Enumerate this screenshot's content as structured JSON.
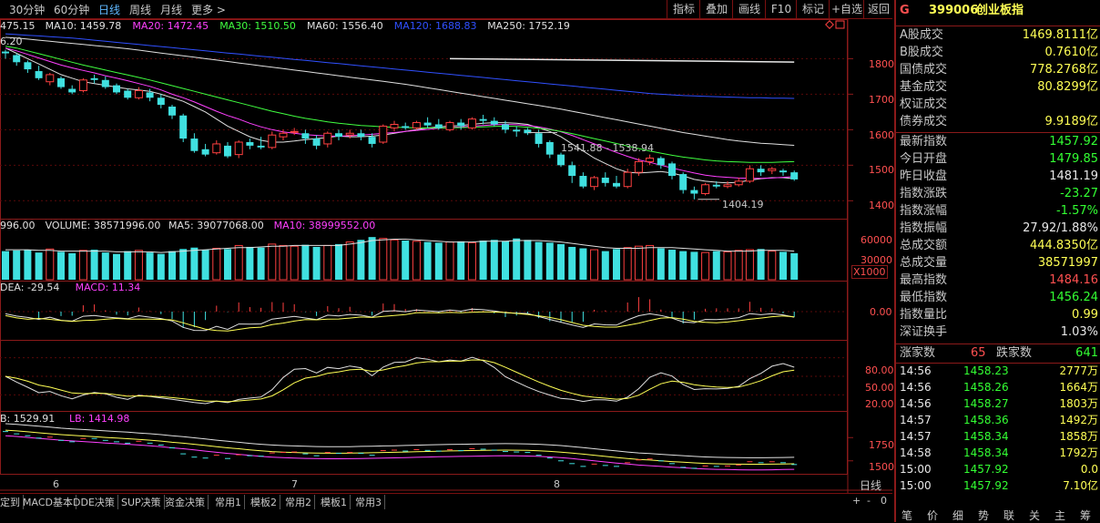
{
  "toolbar": {
    "periods": [
      "30分钟",
      "60分钟",
      "日线",
      "周线",
      "月线",
      "更多 >"
    ],
    "active_period": "日线",
    "buttons": [
      "指标",
      "叠加",
      "画线",
      "F10",
      "标记",
      "+自选",
      "返回"
    ]
  },
  "ma_legend": [
    {
      "text": "475.15",
      "color": "#e0e0e0"
    },
    {
      "text": "MA10: 1459.78",
      "color": "#e0e0e0"
    },
    {
      "text": "MA20: 1472.45",
      "color": "#ff40ff"
    },
    {
      "text": "MA30: 1510.50",
      "color": "#40ff40"
    },
    {
      "text": "MA60: 1556.40",
      "color": "#e0e0e0"
    },
    {
      "text": "MA120: 1688.83",
      "color": "#3050ff"
    },
    {
      "text": "MA250: 1752.19",
      "color": "#e0e0e0"
    }
  ],
  "price_corner": "6.20",
  "price_axis": [
    "1800",
    "1700",
    "1600",
    "1500",
    "1400"
  ],
  "annotations": {
    "high": "1541.88 - 1538.94",
    "low": "1404.19"
  },
  "volume_legend": [
    {
      "text": "996.00",
      "color": "#e0e0e0"
    },
    {
      "text": "VOLUME: 38571996.00",
      "color": "#e0e0e0"
    },
    {
      "text": "MA5: 39077068.00",
      "color": "#e0e0e0"
    },
    {
      "text": "MA10: 38999552.00",
      "color": "#ff40ff"
    }
  ],
  "volume_axis": [
    "60000",
    "30000"
  ],
  "volume_unit": "X1000",
  "macd_legend": [
    {
      "text": "DEA: -29.54",
      "color": "#e0e0e0"
    },
    {
      "text": "MACD: 11.34",
      "color": "#ff40ff"
    }
  ],
  "macd_axis": [
    "0.00"
  ],
  "kdj_axis": [
    "80.00",
    "50.00",
    "20.00"
  ],
  "boll_legend": [
    {
      "text": "B: 1529.91",
      "color": "#e0e0e0"
    },
    {
      "text": "LB: 1414.98",
      "color": "#ff40ff"
    }
  ],
  "boll_axis": [
    "1750",
    "1500"
  ],
  "dates": [
    "6",
    "7",
    "8"
  ],
  "period_label": "日线",
  "zoom": [
    "+",
    "-",
    "0"
  ],
  "bottom_tabs": [
    "定到",
    "MACD基本",
    "DDE决策",
    "SUP决策",
    "资金决策",
    "常用1",
    "模板2",
    "常用2",
    "模板1",
    "常用3"
  ],
  "sidebar": {
    "flag": "G",
    "code": "399006",
    "name": "创业板指",
    "turnover": [
      {
        "k": "A股成交",
        "v": "1469.8111亿",
        "c": "#ffff55"
      },
      {
        "k": "B股成交",
        "v": "0.7610亿",
        "c": "#ffff55"
      },
      {
        "k": "国债成交",
        "v": "778.2768亿",
        "c": "#ffff55"
      },
      {
        "k": "基金成交",
        "v": "80.8299亿",
        "c": "#ffff55"
      },
      {
        "k": "权证成交",
        "v": "",
        "c": "#ffff55"
      },
      {
        "k": "债券成交",
        "v": "9.9189亿",
        "c": "#ffff55"
      }
    ],
    "stats": [
      {
        "k": "最新指数",
        "v": "1457.92",
        "c": "#33ff33"
      },
      {
        "k": "今日开盘",
        "v": "1479.85",
        "c": "#33ff33"
      },
      {
        "k": "昨日收盘",
        "v": "1481.19",
        "c": "#e8e8e8"
      },
      {
        "k": "指数涨跌",
        "v": "-23.27",
        "c": "#33ff33"
      },
      {
        "k": "指数涨幅",
        "v": "-1.57%",
        "c": "#33ff33"
      },
      {
        "k": "指数振幅",
        "v": "27.92/1.88%",
        "c": "#e8e8e8"
      },
      {
        "k": "总成交额",
        "v": "444.8350亿",
        "c": "#ffff55"
      },
      {
        "k": "总成交量",
        "v": "38571997",
        "c": "#ffff55"
      },
      {
        "k": "最高指数",
        "v": "1484.16",
        "c": "#ff5050"
      },
      {
        "k": "最低指数",
        "v": "1456.24",
        "c": "#33ff33"
      },
      {
        "k": "指数量比",
        "v": "0.99",
        "c": "#ffff55"
      },
      {
        "k": "深证换手",
        "v": "1.03%",
        "c": "#e8e8e8"
      }
    ],
    "breadth": {
      "up_label": "涨家数",
      "up": "65",
      "down_label": "跌家数",
      "down": "641"
    },
    "ticks": [
      {
        "time": "14:56",
        "price": "1458.23",
        "vol": "2777万"
      },
      {
        "time": "14:56",
        "price": "1458.26",
        "vol": "1664万"
      },
      {
        "time": "14:56",
        "price": "1458.27",
        "vol": "1803万"
      },
      {
        "time": "14:57",
        "price": "1458.36",
        "vol": "1492万"
      },
      {
        "time": "14:57",
        "price": "1458.34",
        "vol": "1858万"
      },
      {
        "time": "14:58",
        "price": "1458.34",
        "vol": "1792万"
      },
      {
        "time": "15:00",
        "price": "1457.92",
        "vol": "0.0"
      },
      {
        "time": "15:00",
        "price": "1457.92",
        "vol": "7.10亿"
      }
    ],
    "tabs": [
      "笔",
      "价",
      "细",
      "势",
      "联",
      "关",
      "主",
      "筹"
    ]
  },
  "chart_data": {
    "type": "candlestick",
    "candles": [
      [
        1820,
        1815,
        1825,
        1800
      ],
      [
        1810,
        1790,
        1815,
        1780
      ],
      [
        1790,
        1770,
        1795,
        1760
      ],
      [
        1765,
        1745,
        1780,
        1740
      ],
      [
        1735,
        1755,
        1760,
        1725
      ],
      [
        1745,
        1720,
        1750,
        1715
      ],
      [
        1715,
        1705,
        1725,
        1700
      ],
      [
        1710,
        1740,
        1745,
        1705
      ],
      [
        1745,
        1740,
        1755,
        1730
      ],
      [
        1740,
        1720,
        1750,
        1715
      ],
      [
        1725,
        1705,
        1730,
        1700
      ],
      [
        1710,
        1690,
        1715,
        1685
      ],
      [
        1690,
        1710,
        1720,
        1685
      ],
      [
        1705,
        1690,
        1715,
        1680
      ],
      [
        1690,
        1670,
        1700,
        1660
      ],
      [
        1665,
        1640,
        1670,
        1630
      ],
      [
        1640,
        1575,
        1645,
        1565
      ],
      [
        1575,
        1540,
        1590,
        1535
      ],
      [
        1545,
        1530,
        1560,
        1525
      ],
      [
        1535,
        1560,
        1570,
        1530
      ],
      [
        1555,
        1525,
        1565,
        1520
      ],
      [
        1530,
        1565,
        1570,
        1520
      ],
      [
        1565,
        1555,
        1575,
        1545
      ],
      [
        1555,
        1550,
        1580,
        1545
      ],
      [
        1550,
        1585,
        1595,
        1545
      ],
      [
        1580,
        1590,
        1600,
        1570
      ],
      [
        1595,
        1595,
        1605,
        1585
      ],
      [
        1590,
        1575,
        1600,
        1560
      ],
      [
        1575,
        1555,
        1585,
        1545
      ],
      [
        1560,
        1590,
        1595,
        1550
      ],
      [
        1590,
        1580,
        1600,
        1570
      ],
      [
        1585,
        1590,
        1600,
        1575
      ],
      [
        1590,
        1580,
        1600,
        1570
      ],
      [
        1580,
        1560,
        1590,
        1550
      ],
      [
        1565,
        1610,
        1615,
        1560
      ],
      [
        1605,
        1615,
        1625,
        1595
      ],
      [
        1610,
        1605,
        1620,
        1600
      ],
      [
        1605,
        1620,
        1625,
        1600
      ],
      [
        1620,
        1612,
        1635,
        1605
      ],
      [
        1615,
        1605,
        1630,
        1600
      ],
      [
        1600,
        1620,
        1625,
        1595
      ],
      [
        1620,
        1610,
        1630,
        1600
      ],
      [
        1605,
        1630,
        1635,
        1600
      ],
      [
        1630,
        1625,
        1642,
        1615
      ],
      [
        1625,
        1615,
        1635,
        1610
      ],
      [
        1615,
        1600,
        1625,
        1590
      ],
      [
        1600,
        1595,
        1610,
        1580
      ],
      [
        1600,
        1590,
        1605,
        1585
      ],
      [
        1590,
        1560,
        1600,
        1550
      ],
      [
        1565,
        1530,
        1570,
        1520
      ],
      [
        1530,
        1500,
        1535,
        1495
      ],
      [
        1500,
        1470,
        1510,
        1450
      ],
      [
        1470,
        1440,
        1480,
        1435
      ],
      [
        1440,
        1465,
        1470,
        1430
      ],
      [
        1465,
        1450,
        1480,
        1440
      ],
      [
        1450,
        1440,
        1470,
        1435
      ],
      [
        1440,
        1480,
        1490,
        1435
      ],
      [
        1480,
        1510,
        1520,
        1470
      ],
      [
        1510,
        1520,
        1530,
        1500
      ],
      [
        1520,
        1500,
        1525,
        1490
      ],
      [
        1505,
        1470,
        1510,
        1460
      ],
      [
        1475,
        1430,
        1480,
        1420
      ],
      [
        1430,
        1420,
        1440,
        1404
      ],
      [
        1420,
        1445,
        1450,
        1415
      ],
      [
        1445,
        1440,
        1455,
        1435
      ],
      [
        1440,
        1445,
        1455,
        1435
      ],
      [
        1445,
        1455,
        1465,
        1440
      ],
      [
        1455,
        1490,
        1500,
        1450
      ],
      [
        1490,
        1480,
        1500,
        1470
      ],
      [
        1485,
        1490,
        1495,
        1475
      ],
      [
        1485,
        1480,
        1490,
        1470
      ],
      [
        1480,
        1460,
        1485,
        1456
      ]
    ],
    "ma_lines": [
      {
        "name": "MA10",
        "color": "#e0e0e0",
        "values": [
          1830,
          1815,
          1800,
          1785,
          1770,
          1755,
          1745,
          1735,
          1730,
          1725,
          1720,
          1715,
          1712,
          1708,
          1700,
          1690,
          1680,
          1665,
          1650,
          1630,
          1610,
          1595,
          1580,
          1570,
          1565,
          1565,
          1568,
          1572,
          1575,
          1578,
          1582,
          1580,
          1580,
          1582,
          1585,
          1590,
          1595,
          1600,
          1605,
          1608,
          1610,
          1612,
          1615,
          1618,
          1620,
          1620,
          1618,
          1615,
          1605,
          1595,
          1580,
          1560,
          1540,
          1520,
          1505,
          1490,
          1480,
          1478,
          1480,
          1482,
          1478,
          1470,
          1460,
          1455,
          1452,
          1450,
          1452,
          1458,
          1462,
          1465,
          1465,
          1462
        ]
      },
      {
        "name": "MA20",
        "color": "#ff40ff",
        "values": [
          1830,
          1822,
          1812,
          1802,
          1792,
          1782,
          1774,
          1767,
          1760,
          1752,
          1745,
          1738,
          1730,
          1722,
          1712,
          1700,
          1690,
          1678,
          1665,
          1652,
          1640,
          1630,
          1618,
          1608,
          1600,
          1594,
          1590,
          1586,
          1584,
          1582,
          1582,
          1583,
          1585,
          1587,
          1590,
          1592,
          1595,
          1598,
          1601,
          1604,
          1606,
          1608,
          1610,
          1612,
          1614,
          1615,
          1614,
          1612,
          1608,
          1602,
          1594,
          1584,
          1572,
          1560,
          1548,
          1536,
          1525,
          1515,
          1508,
          1500,
          1492,
          1485,
          1478,
          1472,
          1468,
          1466,
          1464,
          1463,
          1463,
          1464,
          1466,
          1468
        ]
      },
      {
        "name": "MA30",
        "color": "#40ff40",
        "values": [
          1835,
          1830,
          1822,
          1814,
          1806,
          1798,
          1790,
          1782,
          1775,
          1768,
          1761,
          1754,
          1747,
          1740,
          1732,
          1724,
          1716,
          1708,
          1700,
          1692,
          1684,
          1676,
          1668,
          1660,
          1652,
          1645,
          1638,
          1632,
          1627,
          1622,
          1618,
          1615,
          1612,
          1610,
          1608,
          1607,
          1606,
          1605,
          1605,
          1605,
          1605,
          1606,
          1607,
          1608,
          1609,
          1610,
          1609,
          1607,
          1604,
          1600,
          1595,
          1589,
          1582,
          1575,
          1568,
          1561,
          1554,
          1547,
          1540,
          1534,
          1528,
          1523,
          1519,
          1515,
          1512,
          1510,
          1509,
          1508,
          1508,
          1508,
          1509,
          1510
        ]
      },
      {
        "name": "MA60",
        "color": "#e0e0e0",
        "values": [
          1860,
          1858,
          1855,
          1852,
          1849,
          1846,
          1843,
          1840,
          1837,
          1834,
          1831,
          1828,
          1824,
          1820,
          1816,
          1812,
          1808,
          1804,
          1800,
          1796,
          1792,
          1788,
          1784,
          1780,
          1776,
          1772,
          1768,
          1764,
          1760,
          1756,
          1752,
          1748,
          1744,
          1740,
          1736,
          1732,
          1728,
          1723,
          1718,
          1713,
          1708,
          1703,
          1698,
          1693,
          1688,
          1683,
          1678,
          1673,
          1668,
          1663,
          1658,
          1652,
          1646,
          1640,
          1634,
          1628,
          1622,
          1616,
          1610,
          1604,
          1598,
          1592,
          1587,
          1582,
          1577,
          1572,
          1568,
          1565,
          1562,
          1560,
          1558,
          1556
        ]
      },
      {
        "name": "MA120",
        "color": "#3050ff",
        "values": [
          1870,
          1868,
          1866,
          1864,
          1862,
          1860,
          1858,
          1855,
          1852,
          1849,
          1846,
          1843,
          1840,
          1837,
          1834,
          1831,
          1828,
          1825,
          1822,
          1819,
          1816,
          1813,
          1810,
          1807,
          1804,
          1801,
          1798,
          1795,
          1792,
          1789,
          1786,
          1783,
          1780,
          1777,
          1774,
          1771,
          1768,
          1765,
          1762,
          1759,
          1756,
          1753,
          1750,
          1747,
          1744,
          1741,
          1738,
          1735,
          1732,
          1729,
          1726,
          1723,
          1720,
          1717,
          1714,
          1711,
          1708,
          1705,
          1702,
          1700,
          1698,
          1696,
          1695,
          1694,
          1693,
          1692,
          1691,
          1690,
          1690,
          1689,
          1689,
          1688
        ]
      }
    ],
    "ma250_segment": {
      "name": "MA250",
      "color": "#e8e8e8",
      "values": [
        1800,
        1752
      ]
    },
    "volume": [
      42,
      43,
      44,
      40,
      45,
      41,
      39,
      43,
      44,
      40,
      38,
      42,
      43,
      40,
      38,
      42,
      45,
      47,
      44,
      46,
      45,
      50,
      48,
      47,
      52,
      50,
      49,
      51,
      48,
      50,
      52,
      55,
      58,
      62,
      60,
      58,
      57,
      56,
      55,
      54,
      55,
      56,
      54,
      57,
      58,
      56,
      60,
      58,
      55,
      54,
      52,
      48,
      46,
      44,
      42,
      45,
      47,
      49,
      50,
      46,
      44,
      42,
      41,
      40,
      42,
      41,
      43,
      44,
      45,
      42,
      41,
      39
    ],
    "vol_ma5": [
      44,
      44,
      44,
      43,
      43,
      42,
      42,
      42,
      42,
      42,
      41,
      41,
      41,
      41,
      40,
      41,
      42,
      43,
      44,
      45,
      46,
      47,
      47,
      48,
      49,
      49,
      50,
      50,
      50,
      50,
      50,
      52,
      54,
      57,
      58,
      59,
      59,
      58,
      57,
      56,
      55,
      55,
      55,
      56,
      56,
      56,
      57,
      57,
      57,
      56,
      55,
      53,
      51,
      49,
      47,
      46,
      46,
      46,
      47,
      47,
      47,
      46,
      45,
      44,
      43,
      42,
      42,
      42,
      43,
      43,
      43,
      42
    ]
  }
}
